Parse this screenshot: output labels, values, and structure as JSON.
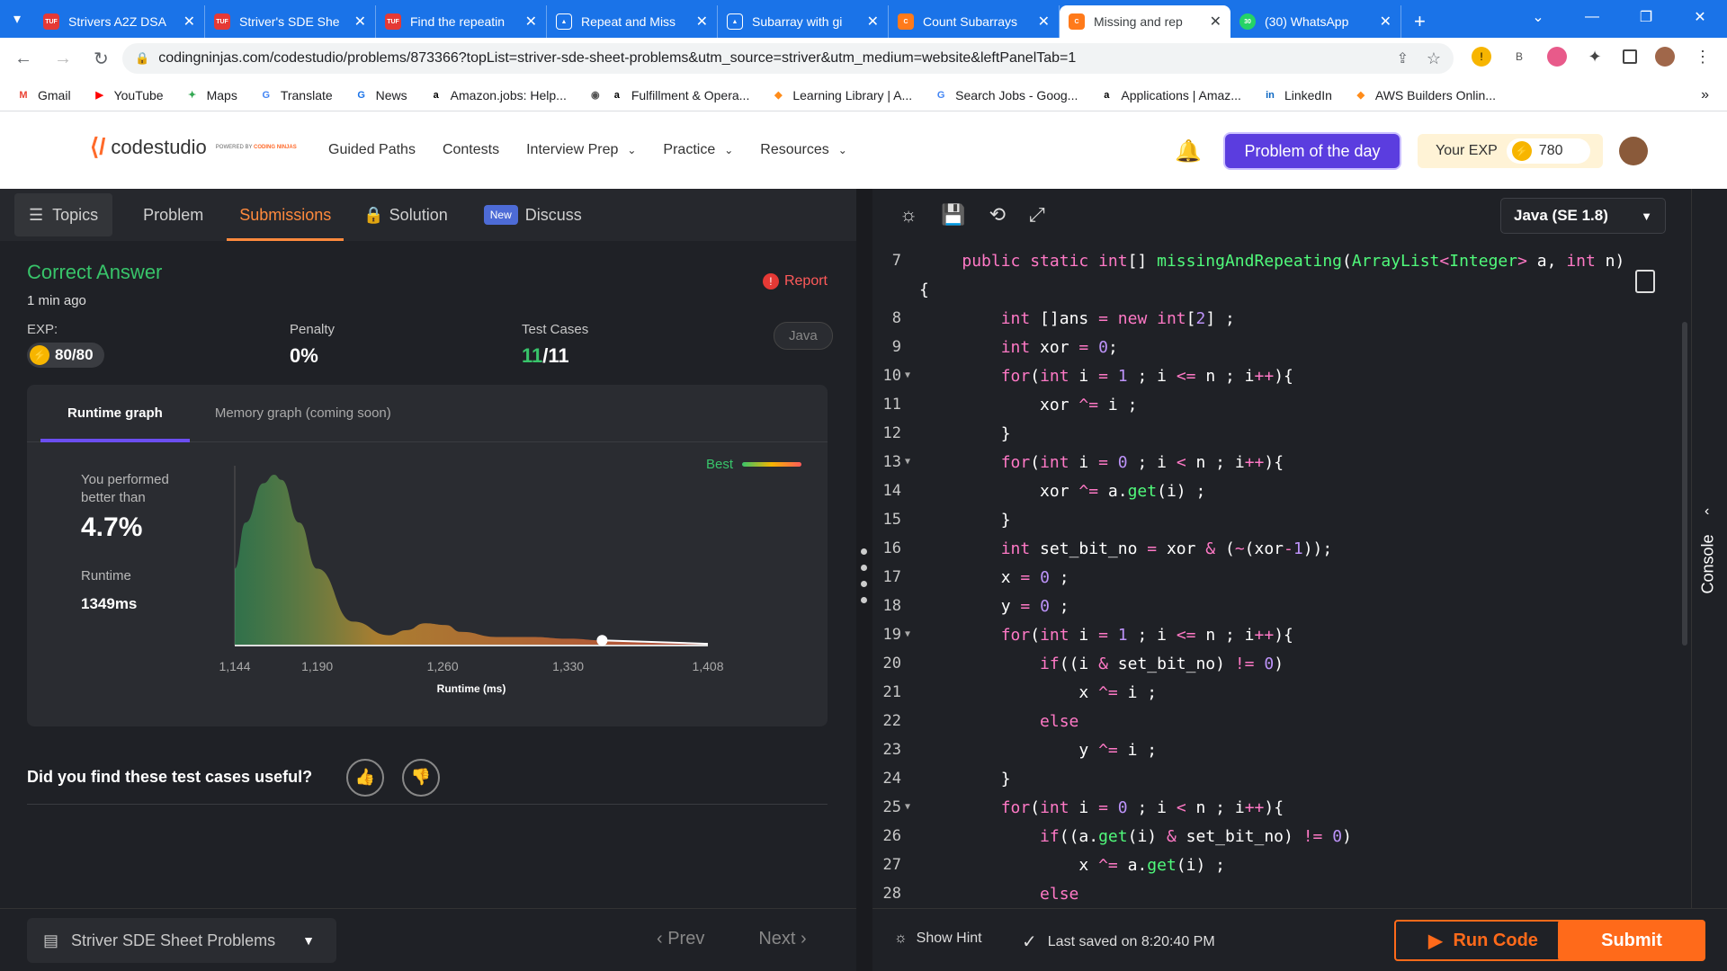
{
  "browser": {
    "tabs": [
      {
        "title": "Strivers A2Z DSA",
        "icon": "tuf-icon"
      },
      {
        "title": "Striver's SDE She",
        "icon": "tuf-icon"
      },
      {
        "title": "Find the repeatin",
        "icon": "tuf-icon"
      },
      {
        "title": "Repeat and Miss",
        "icon": "interviewbit-icon"
      },
      {
        "title": "Subarray with gi",
        "icon": "interviewbit-icon"
      },
      {
        "title": "Count Subarrays",
        "icon": "codingninjas-icon"
      },
      {
        "title": "Missing and rep",
        "icon": "codingninjas-icon",
        "active": true
      },
      {
        "title": "(30) WhatsApp",
        "icon": "whatsapp-icon"
      }
    ],
    "tuf_badge": "TUF",
    "wa_badge": "30",
    "url": "codingninjas.com/codestudio/problems/873366?topList=striver-sde-sheet-problems&utm_source=striver&utm_medium=website&leftPanelTab=1",
    "bookmarks": [
      "Gmail",
      "YouTube",
      "Maps",
      "Translate",
      "News",
      "Amazon.jobs: Help...",
      "Fulfillment & Opera...",
      "Learning Library | A...",
      "Search Jobs - Goog...",
      "Applications | Amaz...",
      "LinkedIn",
      "AWS Builders Onlin..."
    ]
  },
  "site": {
    "brand": "codestudio",
    "brand_sub": "POWERED BY",
    "brand_ninjas": "CODING NINJAS",
    "nav": [
      "Guided Paths",
      "Contests",
      "Interview Prep",
      "Practice",
      "Resources"
    ],
    "potd": "Problem of the day",
    "exp_label": "Your EXP",
    "exp_value": "780"
  },
  "left": {
    "tabs": {
      "topics": "Topics",
      "problem": "Problem",
      "submissions": "Submissions",
      "solution": "Solution",
      "new": "New",
      "discuss": "Discuss"
    },
    "result": "Correct Answer",
    "ago": "1 min ago",
    "report": "Report",
    "exp_label": "EXP:",
    "exp_value": "80/80",
    "penalty_label": "Penalty",
    "penalty_value": "0%",
    "tests_label": "Test Cases",
    "tests_passed": "11",
    "tests_total": "/11",
    "lang": "Java",
    "graph_tabs": [
      "Runtime graph",
      "Memory graph (coming soon)"
    ],
    "perf_label": "You performed better than",
    "perf_value": "4.7%",
    "runtime_label": "Runtime",
    "runtime_value": "1349ms",
    "best_label": "Best",
    "feedback": "Did you find these test cases useful?",
    "sheet": "Striver SDE Sheet Problems",
    "prev": "Prev",
    "next": "Next"
  },
  "chart_data": {
    "type": "area",
    "x_ticks": [
      "1,144",
      "1,190",
      "1,260",
      "1,330",
      "1,408"
    ],
    "x_tick_values": [
      1144,
      1190,
      1260,
      1330,
      1408
    ],
    "xlabel": "Runtime (ms)",
    "xlim": [
      1144,
      1408
    ],
    "x": [
      1144,
      1150,
      1160,
      1166,
      1170,
      1180,
      1190,
      1210,
      1230,
      1240,
      1250,
      1262,
      1270,
      1290,
      1310,
      1330,
      1350,
      1380,
      1408
    ],
    "y": [
      0.45,
      0.72,
      0.95,
      1.0,
      0.97,
      0.72,
      0.45,
      0.14,
      0.06,
      0.09,
      0.13,
      0.12,
      0.08,
      0.05,
      0.05,
      0.04,
      0.03,
      0.015,
      0.01
    ],
    "marker": {
      "x": 1349
    },
    "colors": [
      "#38c46a",
      "#e0a030",
      "#e5533d"
    ]
  },
  "editor": {
    "language": "Java (SE 1.8)",
    "lines": [
      {
        "n": "7",
        "tokens": [
          [
            "",
            "    "
          ],
          [
            "kw",
            "public static "
          ],
          [
            "ty",
            "int"
          ],
          [
            "",
            "[] "
          ],
          [
            "fn",
            "missingAndRepeating"
          ],
          [
            "",
            "("
          ],
          [
            "fn",
            "ArrayList"
          ],
          [
            "kw",
            "<"
          ],
          [
            "fn",
            "Integer"
          ],
          [
            "kw",
            ">"
          ],
          [
            "",
            " a, "
          ],
          [
            "ty",
            "int"
          ],
          [
            "",
            " n)"
          ]
        ]
      },
      {
        "n": "",
        "tokens": [
          [
            "",
            "{"
          ]
        ],
        "pad": -1
      },
      {
        "n": "8",
        "tokens": [
          [
            "",
            "        "
          ],
          [
            "ty",
            "int"
          ],
          [
            "",
            " []ans "
          ],
          [
            "kw",
            "="
          ],
          [
            "",
            " "
          ],
          [
            "kw",
            "new"
          ],
          [
            "",
            " "
          ],
          [
            "ty",
            "int"
          ],
          [
            "",
            "["
          ],
          [
            "num",
            "2"
          ],
          [
            "",
            "] ;"
          ]
        ]
      },
      {
        "n": "9",
        "tokens": [
          [
            "",
            "        "
          ],
          [
            "ty",
            "int"
          ],
          [
            "",
            " xor "
          ],
          [
            "kw",
            "="
          ],
          [
            "",
            " "
          ],
          [
            "num",
            "0"
          ],
          [
            "",
            ";"
          ]
        ]
      },
      {
        "n": "10",
        "fold": true,
        "tokens": [
          [
            "",
            "        "
          ],
          [
            "kw",
            "for"
          ],
          [
            "",
            "("
          ],
          [
            "ty",
            "int"
          ],
          [
            "",
            " i "
          ],
          [
            "kw",
            "="
          ],
          [
            "",
            " "
          ],
          [
            "num",
            "1"
          ],
          [
            "",
            " ; i "
          ],
          [
            "kw",
            "<="
          ],
          [
            "",
            " n ; i"
          ],
          [
            "kw",
            "++"
          ],
          [
            "",
            "){"
          ]
        ]
      },
      {
        "n": "11",
        "tokens": [
          [
            "",
            "            xor "
          ],
          [
            "kw",
            "^="
          ],
          [
            "",
            " i ;"
          ]
        ]
      },
      {
        "n": "12",
        "tokens": [
          [
            "",
            "        }"
          ]
        ]
      },
      {
        "n": "13",
        "fold": true,
        "tokens": [
          [
            "",
            "        "
          ],
          [
            "kw",
            "for"
          ],
          [
            "",
            "("
          ],
          [
            "ty",
            "int"
          ],
          [
            "",
            " i "
          ],
          [
            "kw",
            "="
          ],
          [
            "",
            " "
          ],
          [
            "num",
            "0"
          ],
          [
            "",
            " ; i "
          ],
          [
            "kw",
            "<"
          ],
          [
            "",
            " n ; i"
          ],
          [
            "kw",
            "++"
          ],
          [
            "",
            "){"
          ]
        ]
      },
      {
        "n": "14",
        "tokens": [
          [
            "",
            "            xor "
          ],
          [
            "kw",
            "^="
          ],
          [
            "",
            " a."
          ],
          [
            "fn",
            "get"
          ],
          [
            "",
            "(i) ;"
          ]
        ]
      },
      {
        "n": "15",
        "tokens": [
          [
            "",
            "        }"
          ]
        ]
      },
      {
        "n": "16",
        "tokens": [
          [
            "",
            "        "
          ],
          [
            "ty",
            "int"
          ],
          [
            "",
            " set_bit_no "
          ],
          [
            "kw",
            "="
          ],
          [
            "",
            " xor "
          ],
          [
            "kw",
            "&"
          ],
          [
            "",
            " ("
          ],
          [
            "kw",
            "~"
          ],
          [
            "",
            "(xor"
          ],
          [
            "kw",
            "-"
          ],
          [
            "num",
            "1"
          ],
          [
            "",
            "));"
          ]
        ]
      },
      {
        "n": "17",
        "tokens": [
          [
            "",
            "        x "
          ],
          [
            "kw",
            "="
          ],
          [
            "",
            " "
          ],
          [
            "num",
            "0"
          ],
          [
            "",
            " ;"
          ]
        ]
      },
      {
        "n": "18",
        "tokens": [
          [
            "",
            "        y "
          ],
          [
            "kw",
            "="
          ],
          [
            "",
            " "
          ],
          [
            "num",
            "0"
          ],
          [
            "",
            " ;"
          ]
        ]
      },
      {
        "n": "19",
        "fold": true,
        "tokens": [
          [
            "",
            "        "
          ],
          [
            "kw",
            "for"
          ],
          [
            "",
            "("
          ],
          [
            "ty",
            "int"
          ],
          [
            "",
            " i "
          ],
          [
            "kw",
            "="
          ],
          [
            "",
            " "
          ],
          [
            "num",
            "1"
          ],
          [
            "",
            " ; i "
          ],
          [
            "kw",
            "<="
          ],
          [
            "",
            " n ; i"
          ],
          [
            "kw",
            "++"
          ],
          [
            "",
            "){"
          ]
        ]
      },
      {
        "n": "20",
        "tokens": [
          [
            "",
            "            "
          ],
          [
            "kw",
            "if"
          ],
          [
            "",
            "((i "
          ],
          [
            "kw",
            "&"
          ],
          [
            "",
            " set_bit_no) "
          ],
          [
            "kw",
            "!="
          ],
          [
            "",
            " "
          ],
          [
            "num",
            "0"
          ],
          [
            "",
            ")"
          ]
        ]
      },
      {
        "n": "21",
        "tokens": [
          [
            "",
            "                x "
          ],
          [
            "kw",
            "^="
          ],
          [
            "",
            " i ;"
          ]
        ]
      },
      {
        "n": "22",
        "tokens": [
          [
            "",
            "            "
          ],
          [
            "kw",
            "else"
          ]
        ]
      },
      {
        "n": "23",
        "tokens": [
          [
            "",
            "                y "
          ],
          [
            "kw",
            "^="
          ],
          [
            "",
            " i ;"
          ]
        ]
      },
      {
        "n": "24",
        "tokens": [
          [
            "",
            "        }"
          ]
        ]
      },
      {
        "n": "25",
        "fold": true,
        "tokens": [
          [
            "",
            "        "
          ],
          [
            "kw",
            "for"
          ],
          [
            "",
            "("
          ],
          [
            "ty",
            "int"
          ],
          [
            "",
            " i "
          ],
          [
            "kw",
            "="
          ],
          [
            "",
            " "
          ],
          [
            "num",
            "0"
          ],
          [
            "",
            " ; i "
          ],
          [
            "kw",
            "<"
          ],
          [
            "",
            " n ; i"
          ],
          [
            "kw",
            "++"
          ],
          [
            "",
            "){"
          ]
        ]
      },
      {
        "n": "26",
        "tokens": [
          [
            "",
            "            "
          ],
          [
            "kw",
            "if"
          ],
          [
            "",
            "((a."
          ],
          [
            "fn",
            "get"
          ],
          [
            "",
            "(i) "
          ],
          [
            "kw",
            "&"
          ],
          [
            "",
            " set_bit_no) "
          ],
          [
            "kw",
            "!="
          ],
          [
            "",
            " "
          ],
          [
            "num",
            "0"
          ],
          [
            "",
            ")"
          ]
        ]
      },
      {
        "n": "27",
        "tokens": [
          [
            "",
            "                x "
          ],
          [
            "kw",
            "^="
          ],
          [
            "",
            " a."
          ],
          [
            "fn",
            "get"
          ],
          [
            "",
            "(i) ;"
          ]
        ]
      },
      {
        "n": "28",
        "tokens": [
          [
            "",
            "            "
          ],
          [
            "kw",
            "else"
          ]
        ]
      }
    ],
    "show_hint": "Show Hint",
    "saved": "Last saved on 8:20:40 PM",
    "run": "Run Code",
    "submit": "Submit",
    "console": "Console"
  }
}
